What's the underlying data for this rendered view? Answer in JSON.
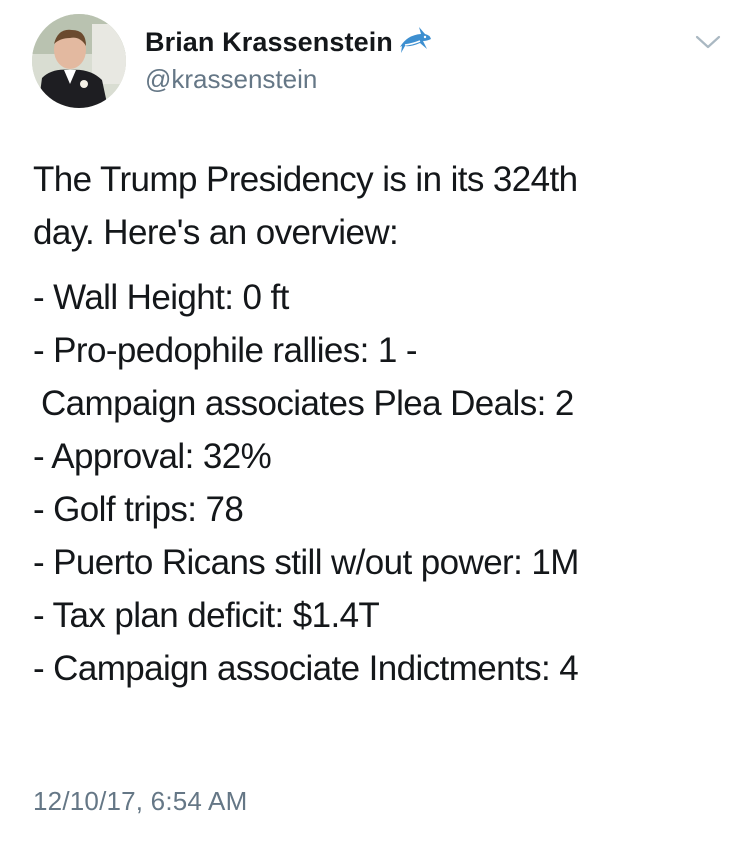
{
  "tweet": {
    "author": {
      "display_name": "Brian Krassenstein",
      "handle": "@krassenstein",
      "badge_icon": "shark-emoji-icon",
      "avatar_icon": "profile-photo-avatar"
    },
    "menu_icon": "chevron-down-icon",
    "text": {
      "intro": "The Trump Presidency is in its 324th day. Here's an overview:",
      "intro_line_1": "The Trump Presidency is in its 324th",
      "intro_line_2": "day. Here's an overview:",
      "lines": [
        "- Wall Height: 0 ft",
        "- Pro-pedophile rallies: 1 -",
        " Campaign associates Plea Deals: 2",
        "- Approval: 32%",
        "- Golf trips: 78",
        "- Puerto Ricans still w/out power: 1M",
        "- Tax plan deficit: $1.4T",
        "- Campaign associate Indictments: 4"
      ]
    },
    "timestamp": "12/10/17, 6:54 AM"
  },
  "colors": {
    "text_primary": "#14171a",
    "text_secondary": "#657786",
    "background": "#ffffff",
    "shark_blue": "#3d8fd0"
  }
}
